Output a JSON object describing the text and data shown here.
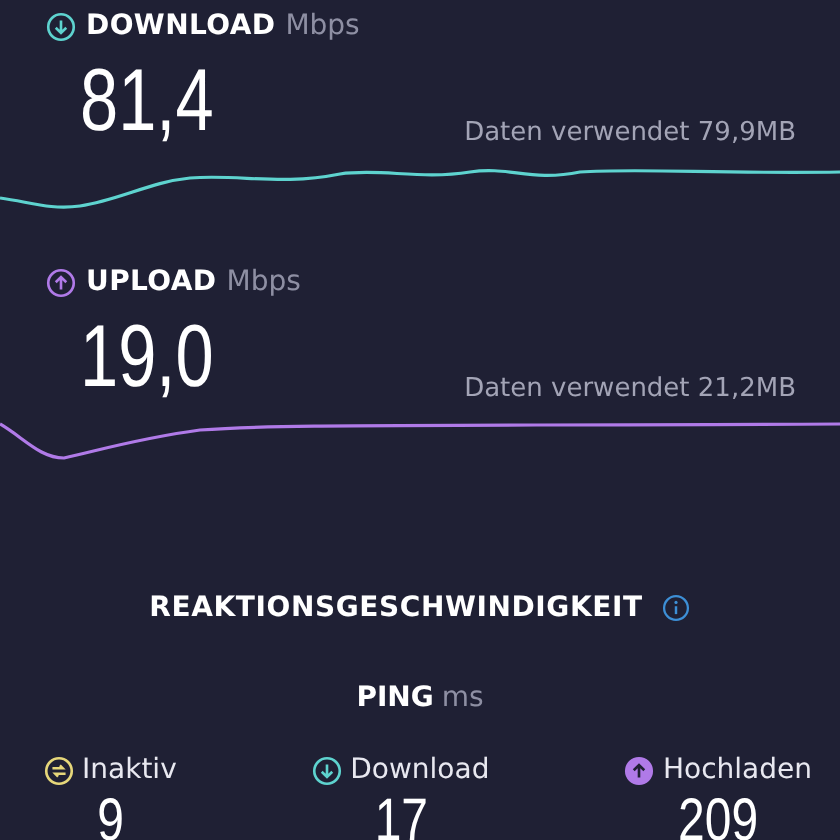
{
  "speeds": [
    {
      "kind": "download",
      "label": "DOWNLOAD",
      "unit": "Mbps",
      "value": "81,4",
      "data_used": "Daten verwendet 79,9MB"
    },
    {
      "kind": "upload",
      "label": "UPLOAD",
      "unit": "Mbps",
      "value": "19,0",
      "data_used": "Daten verwendet 21,2MB"
    }
  ],
  "latency": {
    "title": "REAKTIONSGESCHWINDIGKEIT",
    "ping_label": "PING",
    "ping_unit": "ms",
    "items": [
      {
        "kind": "idle",
        "label": "Inaktiv",
        "value": "9"
      },
      {
        "kind": "download",
        "label": "Download",
        "value": "17"
      },
      {
        "kind": "upload",
        "label": "Hochladen",
        "value": "209"
      }
    ]
  }
}
